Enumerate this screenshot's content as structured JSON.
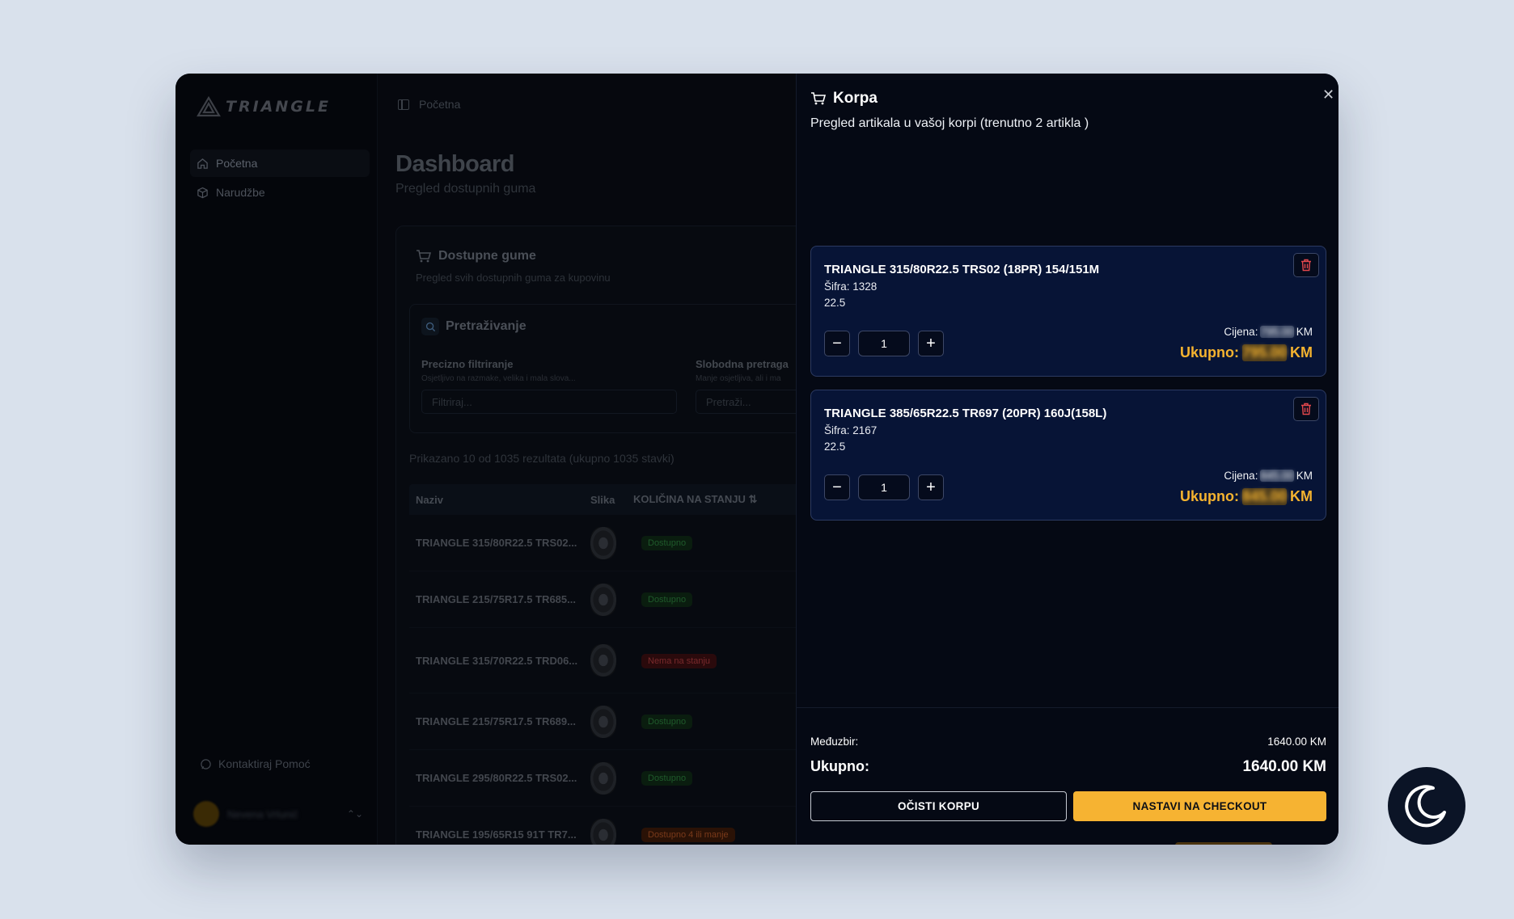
{
  "sidebar": {
    "logo_text": "TRIANGLE",
    "items": [
      {
        "label": "Početna",
        "icon": "home-icon"
      },
      {
        "label": "Narudžbe",
        "icon": "package-icon"
      }
    ],
    "help_label": "Kontaktiraj Pomoć",
    "user_name": "Nevena Vrlunić"
  },
  "topbar": {
    "breadcrumb": "Početna"
  },
  "dashboard": {
    "title": "Dashboard",
    "subtitle": "Pregled dostupnih guma",
    "card_title": "Dostupne gume",
    "card_subtitle": "Pregled svih dostupnih guma za kupovinu",
    "search": {
      "title": "Pretraživanje",
      "precise_label": "Precizno filtriranje",
      "precise_hint": "Osjetljivo na razmake, velika i mala slova...",
      "precise_placeholder": "Filtriraj...",
      "free_label": "Slobodna pretraga",
      "free_hint": "Manje osjetljiva, ali i ma",
      "free_placeholder": "Pretraži..."
    },
    "results_text": "Prikazano 10 od 1035 rezultata (ukupno 1035 stavki)",
    "table": {
      "headers": [
        "Naziv",
        "Slika",
        "KOLIČINA NA STANJU"
      ],
      "rows": [
        {
          "name": "TRIANGLE 315/80R22.5 TRS02...",
          "status": "Dostupno",
          "kind": "ok"
        },
        {
          "name": "TRIANGLE 215/75R17.5 TR685...",
          "status": "Dostupno",
          "kind": "ok"
        },
        {
          "name": "TRIANGLE 315/70R22.5 TRD06...",
          "status": "Nema na stanju",
          "kind": "no"
        },
        {
          "name": "TRIANGLE 215/75R17.5 TR689...",
          "status": "Dostupno",
          "kind": "ok"
        },
        {
          "name": "TRIANGLE 295/80R22.5 TRS02...",
          "status": "Dostupno",
          "kind": "ok"
        },
        {
          "name": "TRIANGLE 195/65R15 91T TR7...",
          "status": "Dostupno 4 ili manje",
          "kind": "warn"
        }
      ]
    }
  },
  "cart": {
    "title": "Korpa",
    "subtitle": "Pregled artikala u vašoj korpi (trenutno 2 artikla )",
    "items": [
      {
        "name": "TRIANGLE 315/80R22.5 TRS02 (18PR) 154/151M",
        "code": "Šifra: 1328",
        "size": "22.5",
        "quantity": "1",
        "price_label": "Cijena:",
        "price_value": "795.00",
        "currency": "KM",
        "total_label": "Ukupno:",
        "total_value": "795.00"
      },
      {
        "name": "TRIANGLE 385/65R22.5 TR697 (20PR) 160J(158L)",
        "code": "Šifra: 2167",
        "size": "22.5",
        "quantity": "1",
        "price_label": "Cijena:",
        "price_value": "845.00",
        "currency": "KM",
        "total_label": "Ukupno:",
        "total_value": "845.00"
      }
    ],
    "subtotal_label": "Međuzbir:",
    "subtotal_value": "1640.00 KM",
    "total_label": "Ukupno:",
    "total_value": "1640.00 KM",
    "clear_label": "OČISTI KORPU",
    "checkout_label": "NASTAVI NA CHECKOUT"
  },
  "colors": {
    "accent": "#f6b332",
    "card_bg": "#071436",
    "card_border": "#2c3a61",
    "danger": "#e5484d"
  }
}
